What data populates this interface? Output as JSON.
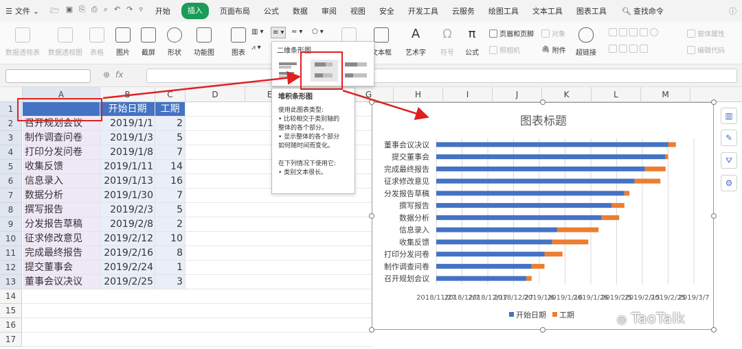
{
  "menubar": {
    "file_label": "文件",
    "tabs": [
      "开始",
      "插入",
      "页面布局",
      "公式",
      "数据",
      "审阅",
      "视图",
      "安全",
      "开发工具",
      "云服务",
      "绘图工具",
      "文本工具",
      "图表工具"
    ],
    "active_tab": "插入",
    "search_label": "查找命令"
  },
  "ribbon": {
    "pivot_table": "数据透视表",
    "pivot_chart": "数据透视图",
    "table": "表格",
    "picture": "图片",
    "screenshot": "截屏",
    "shape": "形状",
    "funcchart": "功能图",
    "chart": "图表",
    "textbox": "文本框",
    "wordart": "艺术字",
    "symbol": "符号",
    "formula": "公式",
    "header_footer": "页眉和页脚",
    "object": "对象",
    "camera": "照相机",
    "attachment": "附件",
    "hyperlink": "超链接",
    "form_props": "窗体属性",
    "edit_code": "编辑代码"
  },
  "dropdown": {
    "title": "二维条形图"
  },
  "tooltip": {
    "title": "堆积条形图",
    "lines": [
      "使用此图表类型:",
      "• 比较相交于类别轴的",
      "整体的各个部分。",
      "• 显示整体的各个部分",
      "如何随时间而变化。",
      "",
      "在下列情况下使用它:",
      "• 类别文本很长。"
    ]
  },
  "columns": [
    "A",
    "B",
    "C",
    "D",
    "E",
    "F",
    "G",
    "H",
    "I",
    "J",
    "K",
    "L",
    "M"
  ],
  "rows": [
    "1",
    "2",
    "3",
    "4",
    "5",
    "6",
    "7",
    "8",
    "9",
    "10",
    "11",
    "12",
    "13",
    "14",
    "15",
    "16",
    "17"
  ],
  "table": {
    "headers": [
      "",
      "开始日期",
      "工期"
    ],
    "rows": [
      [
        "召开规划会议",
        "2019/1/1",
        "2"
      ],
      [
        "制作调查问卷",
        "2019/1/3",
        "5"
      ],
      [
        "打印分发问卷",
        "2019/1/8",
        "7"
      ],
      [
        "收集反馈",
        "2019/1/11",
        "14"
      ],
      [
        "信息录入",
        "2019/1/13",
        "16"
      ],
      [
        "数据分析",
        "2019/1/30",
        "7"
      ],
      [
        "撰写报告",
        "2019/2/3",
        "5"
      ],
      [
        "分发报告草稿",
        "2019/2/8",
        "2"
      ],
      [
        "征求修改意见",
        "2019/2/12",
        "10"
      ],
      [
        "完成最终报告",
        "2019/2/16",
        "8"
      ],
      [
        "提交董事会",
        "2019/2/24",
        "1"
      ],
      [
        "董事会议决议",
        "2019/2/25",
        "3"
      ]
    ]
  },
  "chart_data": {
    "type": "bar",
    "stacked": true,
    "orientation": "horizontal",
    "title": "图表标题",
    "categories": [
      "召开规划会议",
      "制作调查问卷",
      "打印分发问卷",
      "收集反馈",
      "信息录入",
      "数据分析",
      "撰写报告",
      "分发报告草稿",
      "征求修改意见",
      "完成最终报告",
      "提交董事会",
      "董事会议决议"
    ],
    "series": [
      {
        "name": "开始日期",
        "color": "#4472c4",
        "values": [
          "2019/1/1",
          "2019/1/3",
          "2019/1/8",
          "2019/1/11",
          "2019/1/13",
          "2019/1/30",
          "2019/2/3",
          "2019/2/8",
          "2019/2/12",
          "2019/2/16",
          "2019/2/24",
          "2019/2/25"
        ]
      },
      {
        "name": "工期",
        "color": "#ed7d31",
        "values": [
          2,
          5,
          7,
          14,
          16,
          7,
          5,
          2,
          10,
          8,
          1,
          3
        ]
      }
    ],
    "x_tick_labels": [
      "2018/11/27",
      "2018/12/7",
      "2018/12/17",
      "2018/12/27",
      "2019/1/6",
      "2019/1/16",
      "2019/1/26",
      "2019/2/5",
      "2019/2/15",
      "2019/2/25",
      "2019/3/7"
    ],
    "xlim": [
      "2018/11/27",
      "2019/3/7"
    ],
    "grid": true,
    "legend": "bottom"
  },
  "watermark": "TaoTalk"
}
